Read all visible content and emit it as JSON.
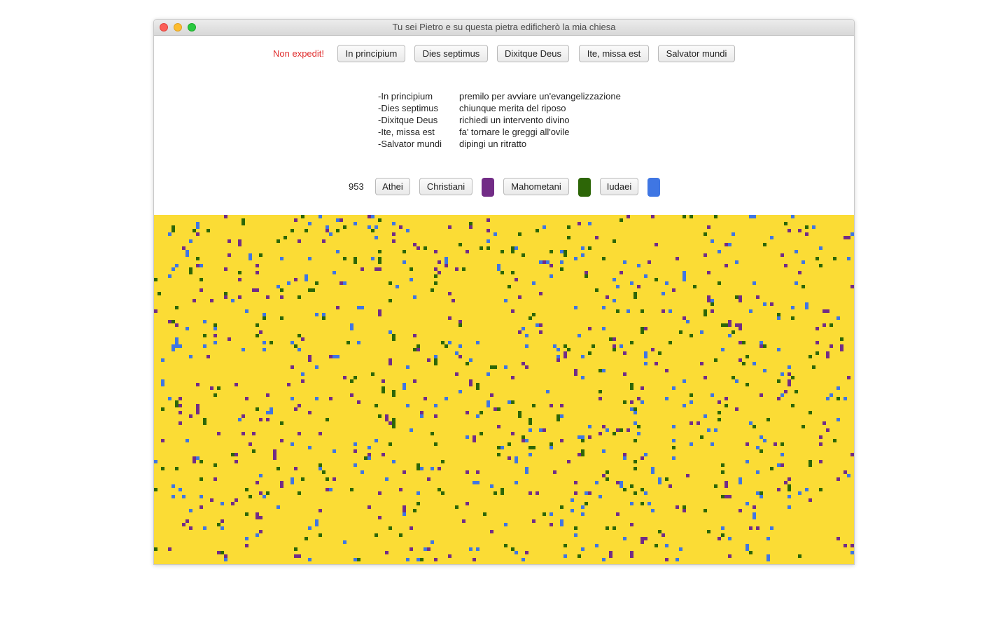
{
  "window": {
    "title": "Tu sei Pietro e su questa pietra edificherò la mia chiesa"
  },
  "toolbar": {
    "status": "Non expedit!",
    "status_color": "#e02e2e",
    "buttons": [
      "In principium",
      "Dies septimus",
      "Dixitque Deus",
      "Ite, missa est",
      "Salvator mundi"
    ]
  },
  "legend": {
    "items": [
      {
        "command": "-In principium",
        "description": "premilo per avviare un'evangelizzazione"
      },
      {
        "command": "-Dies septimus",
        "description": "chiunque merita del riposo"
      },
      {
        "command": "-Dixitque Deus",
        "description": "richiedi un intervento divino"
      },
      {
        "command": "-Ite, missa est",
        "description": "fa' tornare le greggi all'ovile"
      },
      {
        "command": "-Salvator mundi",
        "description": "dipingi un ritratto"
      }
    ]
  },
  "population": {
    "count": "953",
    "groups": [
      {
        "label": "Athei",
        "color": null
      },
      {
        "label": "Christiani",
        "color": "#722c86"
      },
      {
        "label": "Mahometani",
        "color": "#2d6607"
      },
      {
        "label": "Iudaei",
        "color": "#3f76e3"
      }
    ]
  },
  "canvas": {
    "background": "#fbdc35",
    "cell_colors": [
      "#722c86",
      "#2d6607",
      "#3f76e3"
    ]
  }
}
